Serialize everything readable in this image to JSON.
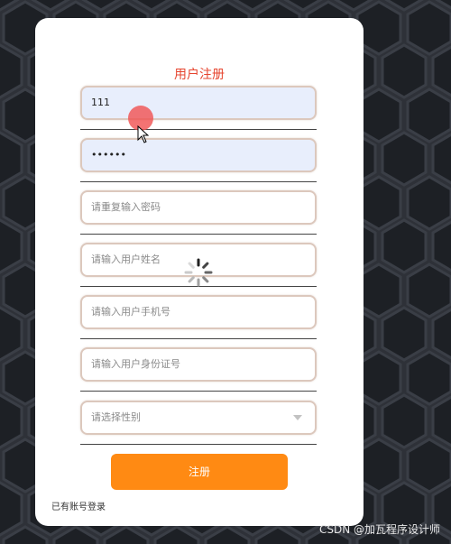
{
  "form": {
    "title": "用户注册",
    "fields": [
      {
        "value": "111",
        "placeholder": ""
      },
      {
        "value": "••••••",
        "placeholder": ""
      },
      {
        "value": "",
        "placeholder": "请重复输入密码"
      },
      {
        "value": "",
        "placeholder": "请输入用户姓名"
      },
      {
        "value": "",
        "placeholder": "请输入用户手机号"
      },
      {
        "value": "",
        "placeholder": "请输入用户身份证号"
      }
    ],
    "gender_select": {
      "placeholder": "请选择性别"
    },
    "submit_label": "注册",
    "login_link": "已有账号登录"
  },
  "watermark": "CSDN @加瓦程序设计师",
  "colors": {
    "title": "#e6452f",
    "submit": "#ff8a13",
    "filled_input": "#e8eefc",
    "background": "#2e3138"
  },
  "icons": {
    "select_arrow": "chevron-down-icon",
    "cursor": "mouse-pointer-icon",
    "loading": "loading-spinner-icon",
    "click_indicator": "click-indicator-icon"
  }
}
